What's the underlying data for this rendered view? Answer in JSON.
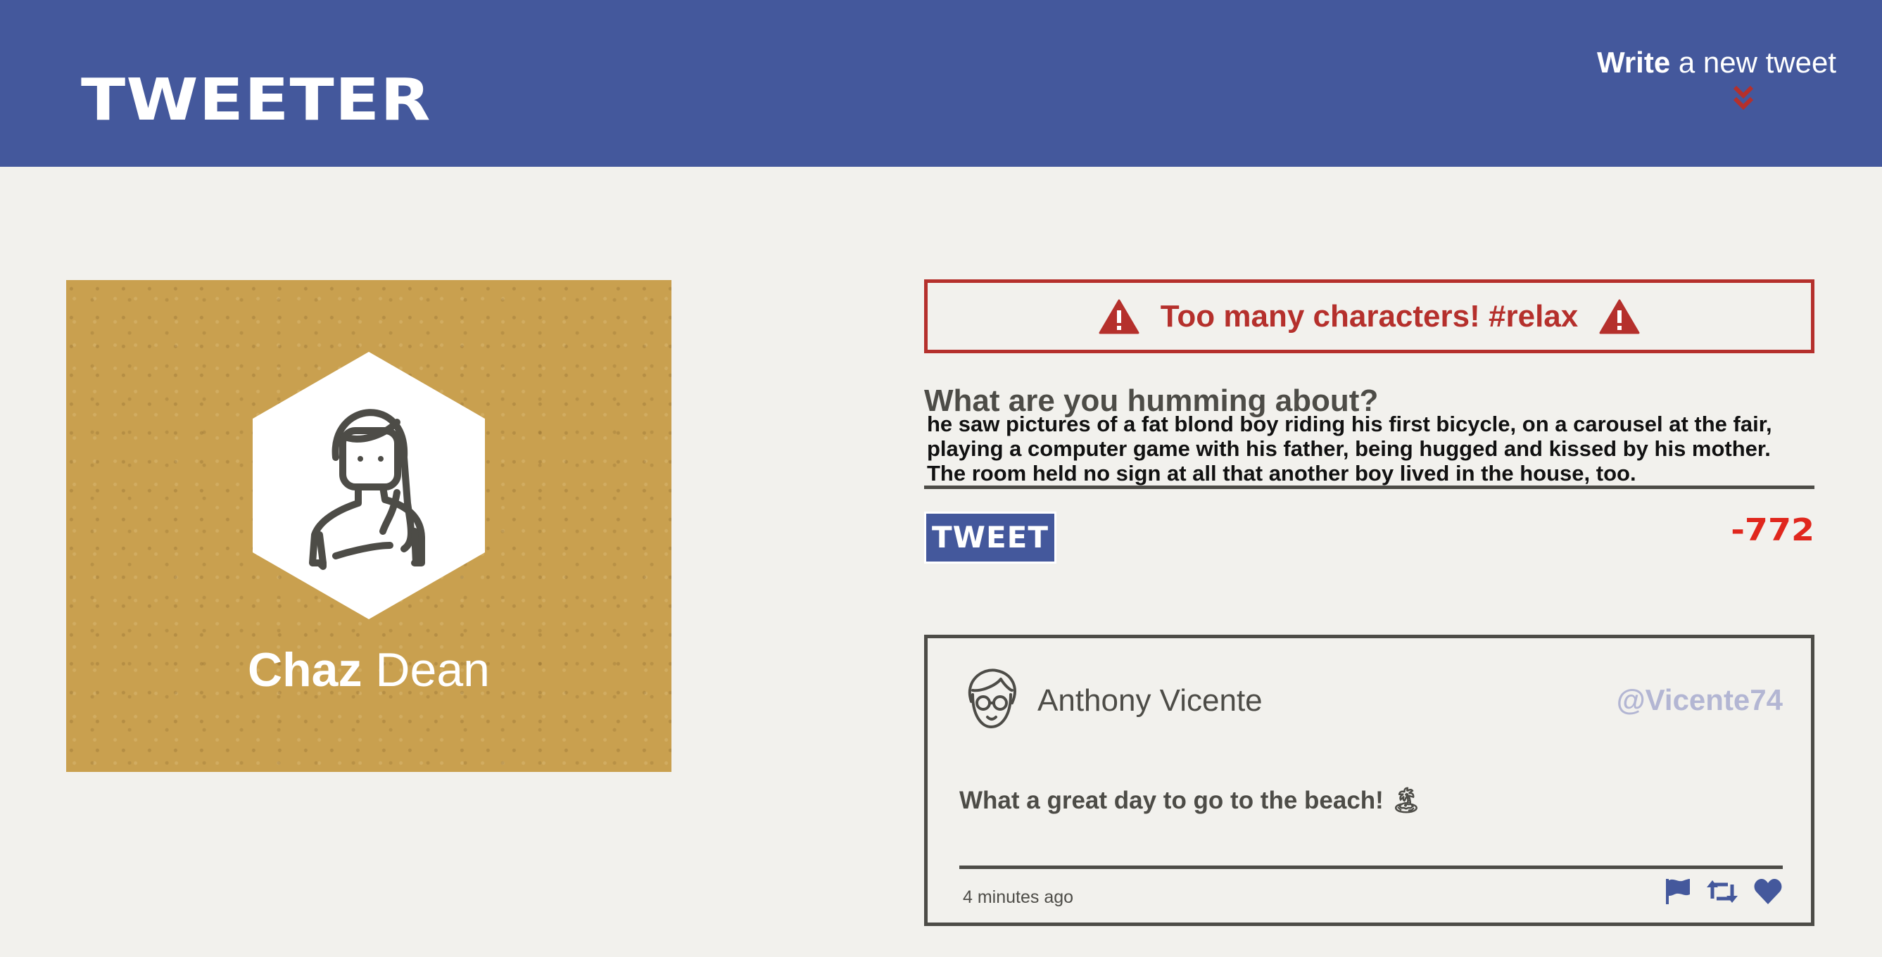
{
  "nav": {
    "logo": "TWEETER",
    "compose_bold": "Write",
    "compose_rest": " a new tweet"
  },
  "profile": {
    "first_name": "Chaz",
    "last_name": " Dean"
  },
  "compose": {
    "error": "Too many characters! #relax",
    "prompt": "What are you humming about?",
    "text": "Then she took Harry to a room with a bed, a chest of drawers and a small desk, and he saw pictures of a fat blond boy riding his first bicycle, on a carousel at the fair, playing a computer game with his father, being hugged and kissed by his mother. The room held no sign at all that another boy lived in the house, too.",
    "button_label": "TWEET",
    "counter": "-772"
  },
  "tweet": {
    "author": "Anthony Vicente",
    "handle": "@Vicente74",
    "content": "What a great day to go to the beach! 🏝",
    "time": "4 minutes ago",
    "icons": [
      "flag-icon",
      "retweet-icon",
      "heart-icon"
    ]
  },
  "colors": {
    "nav": "#44589c",
    "background": "#f2f1ed",
    "profile_card": "#c9a04f",
    "error": "#b5302c",
    "counter": "#e0271d",
    "handle": "#b3b6d3",
    "text": "#4d4c47"
  }
}
